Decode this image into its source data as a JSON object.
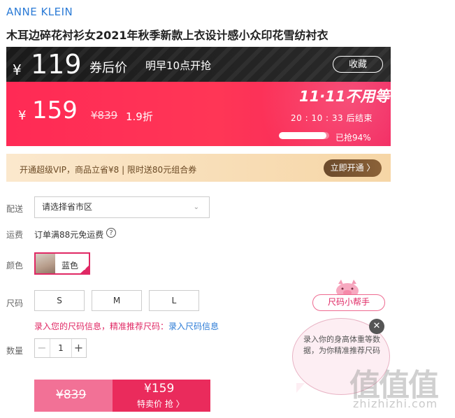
{
  "brand": "ANNE KLEIN",
  "product_title": "木耳边碎花衬衫女2021年秋季新款上衣设计感小众印花雪纺衬衣",
  "coupon_band": {
    "currency": "¥",
    "price": "119",
    "label": "券后价",
    "start_time": "明早10点开抢",
    "favorite_button": "收藏"
  },
  "sale_band": {
    "currency": "¥",
    "price": "159",
    "original_price": "¥839",
    "discount": "1.9折",
    "event_badge": "11·11不用等",
    "countdown": "20 : 10 : 33  后结束",
    "progress": 0.94,
    "progress_text": "已抢94%"
  },
  "vip_banner": {
    "text": "开通超级VIP，商品立省¥8 | 限时送80元组合券",
    "button": "立即开通 〉"
  },
  "delivery": {
    "label": "配送",
    "select_value": "请选择省市区",
    "chevron": "chevron-down-icon"
  },
  "shipping": {
    "label": "运费",
    "text": "订单满88元免运费",
    "help_icon": "?"
  },
  "color": {
    "label": "颜色",
    "selected": "蓝色",
    "check": "✓"
  },
  "size": {
    "label": "尺码",
    "options": [
      "S",
      "M",
      "L"
    ],
    "tip": "录入您的尺码信息，精准推荐尺码：",
    "tip_link": "录入尺码信息"
  },
  "quantity": {
    "label": "数量",
    "minus": "−",
    "value": "1",
    "plus": "+"
  },
  "buy": {
    "original_price": "¥839",
    "price": "¥159",
    "label": "特卖价 抢 〉"
  },
  "size_helper": {
    "button": "尺码小帮手",
    "text": "录入你的身高体重等数据，为你精准推荐尺码",
    "close": "✕"
  },
  "watermark": {
    "logo": "值值值",
    "url": "zhizhizhi.com"
  },
  "colors": {
    "accent_red": "#ff2a55",
    "brand_blue": "#2b7bd6",
    "pink": "#e02864",
    "vip_brown": "#6b4a2c"
  }
}
